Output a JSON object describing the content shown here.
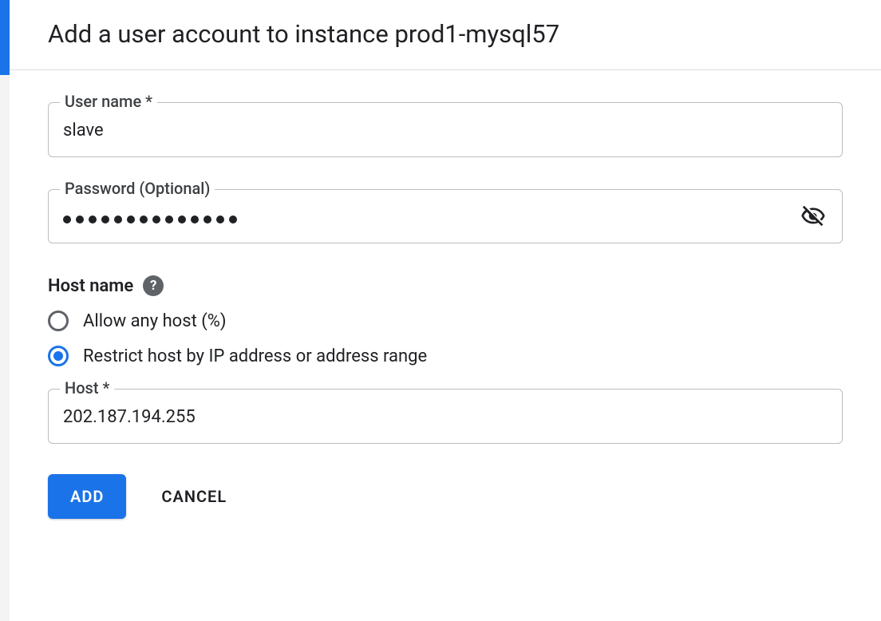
{
  "dialog": {
    "title": "Add a user account to instance prod1-mysql57"
  },
  "form": {
    "username": {
      "label": "User name *",
      "value": "slave"
    },
    "password": {
      "label": "Password (Optional)",
      "masked_length": 14
    },
    "hostname": {
      "section_label": "Host name",
      "options": {
        "any": "Allow any host (%)",
        "restrict": "Restrict host by IP address or address range"
      },
      "selected": "restrict",
      "host_field": {
        "label": "Host *",
        "value": "202.187.194.255"
      }
    }
  },
  "actions": {
    "add": "ADD",
    "cancel": "CANCEL"
  },
  "icons": {
    "help": "?",
    "visibility_off": "visibility-off"
  }
}
